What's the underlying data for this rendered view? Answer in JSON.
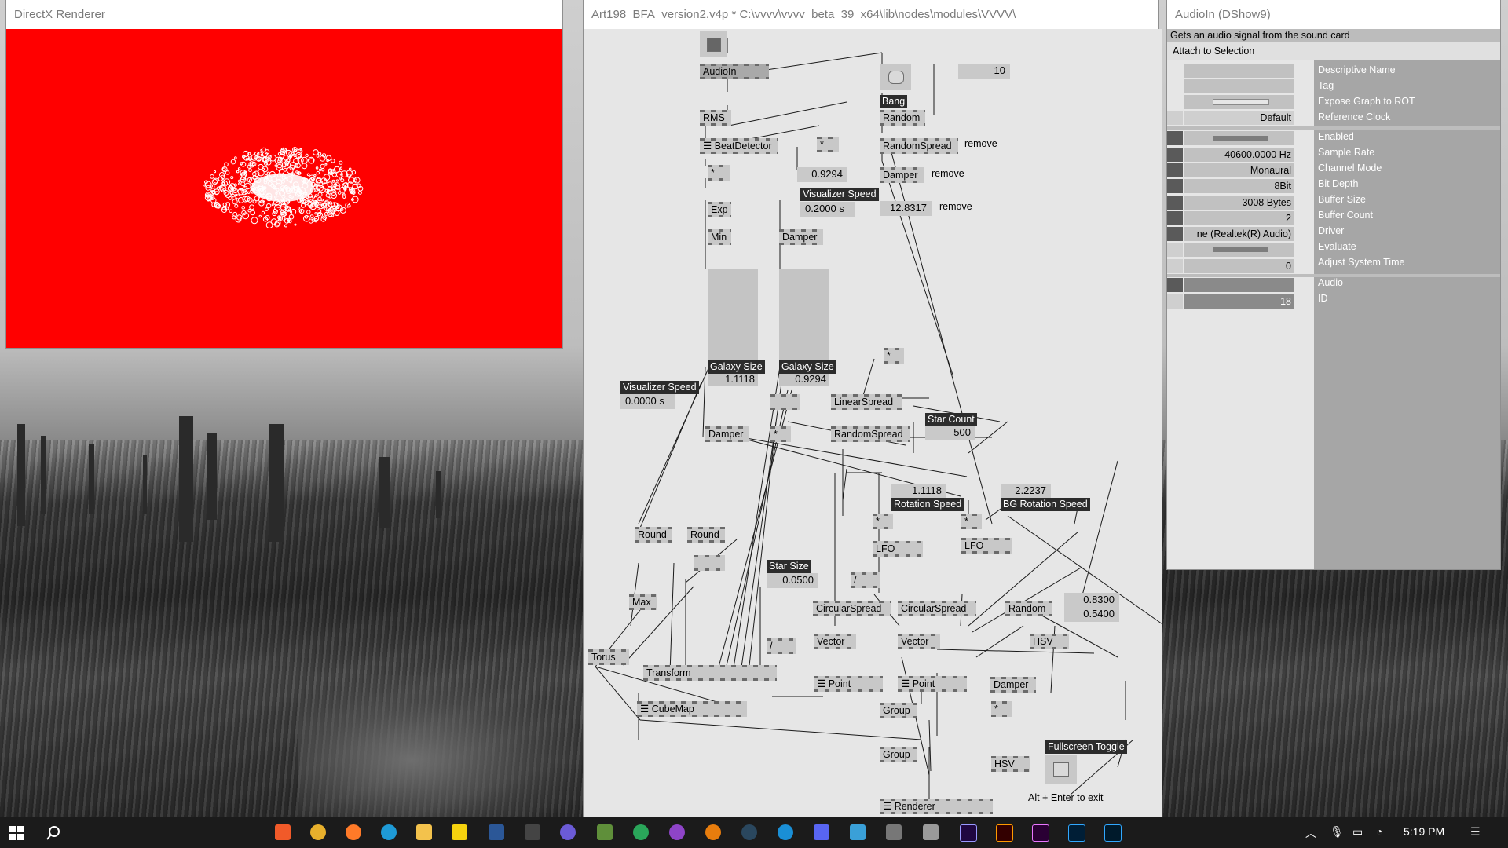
{
  "renderer": {
    "title": "DirectX Renderer",
    "bg_color": "#ff0000"
  },
  "patch": {
    "title": "Art198_BFA_version2.v4p *  C:\\vvvv\\vvvv_beta_39_x64\\lib\\nodes\\modules\\VVVV\\",
    "nodes": {
      "audioin": "AudioIn",
      "rms": "RMS",
      "beatdetector": "BeatDetector",
      "mult1": "*",
      "mult2": "*",
      "exp": "Exp",
      "min": "Min",
      "damper1": "Damper",
      "bang": "Bang",
      "random1": "Random",
      "randomspread1": "RandomSpread",
      "damper2": "Damper",
      "linearspread": "LinearSpread",
      "randomspread2": "RandomSpread",
      "damper3": "Damper",
      "mult3": "*",
      "mult4": "*",
      "mult5": "*",
      "mult6": "*",
      "mult7": "*",
      "lfo1": "LFO",
      "lfo2": "LFO",
      "round1": "Round",
      "round2": "Round",
      "max": "Max",
      "torus": "Torus",
      "transform": "Transform",
      "cubemap": "CubeMap",
      "circularspread1": "CircularSpread",
      "circularspread2": "CircularSpread",
      "vector1": "Vector",
      "vector2": "Vector",
      "point1": "Point",
      "point2": "Point",
      "random2": "Random",
      "hsv1": "HSV",
      "damper4": "Damper",
      "mult8": "*",
      "hsv2": "HSV",
      "group1": "Group",
      "group2": "Group",
      "renderer": "Renderer",
      "div1": "/",
      "div2": "/",
      "div3": "/"
    },
    "values": {
      "ten": "10",
      "v09294": "0.9294",
      "vis_speed_1": "0.2000 s",
      "v128317": "12.8317",
      "slider1": "1.1118",
      "slider2": "0.9294",
      "vis_speed_2": "0.0000 s",
      "star_count": "500",
      "rot_speed": "1.1118",
      "bg_rot_speed": "2.2237",
      "star_size": "0.0500",
      "hsv_a": "0.8300",
      "hsv_b": "0.5400"
    },
    "labels": {
      "bang": "Bang",
      "visualizer_speed": "Visualizer Speed",
      "visualizer_speed_2": "Visualizer Speed",
      "galaxy_size_1": "Galaxy Size",
      "galaxy_size_2": "Galaxy Size",
      "star_count": "Star Count",
      "rotation_speed": "Rotation Speed",
      "bg_rotation_speed": "BG Rotation Speed",
      "star_size": "Star Size",
      "fullscreen_toggle": "Fullscreen Toggle"
    },
    "comments": {
      "remove1": "remove",
      "remove2": "remove",
      "remove3": "remove",
      "alt_enter": "Alt + Enter to exit"
    }
  },
  "inspector": {
    "title": "AudioIn (DShow9)",
    "description": "Gets an audio signal from the sound card",
    "attach": "Attach to Selection",
    "pins": [
      {
        "name": "Descriptive Name",
        "value": ""
      },
      {
        "name": "Tag",
        "value": ""
      },
      {
        "name": "Expose Graph to ROT",
        "value": ""
      },
      {
        "name": "Reference Clock",
        "value": "Default"
      },
      {
        "name": "Enabled",
        "value": ""
      },
      {
        "name": "Sample Rate",
        "value": "40600.0000 Hz"
      },
      {
        "name": "Channel Mode",
        "value": "Monaural"
      },
      {
        "name": "Bit Depth",
        "value": "8Bit"
      },
      {
        "name": "Buffer Size",
        "value": "3008 Bytes"
      },
      {
        "name": "Buffer Count",
        "value": "2"
      },
      {
        "name": "Driver",
        "value": "ne (Realtek(R) Audio)"
      },
      {
        "name": "Evaluate",
        "value": ""
      },
      {
        "name": "Adjust System Time",
        "value": "0"
      },
      {
        "name": "Audio",
        "value": ""
      },
      {
        "name": "ID",
        "value": "18"
      }
    ]
  },
  "taskbar": {
    "time": "5:19 PM"
  }
}
